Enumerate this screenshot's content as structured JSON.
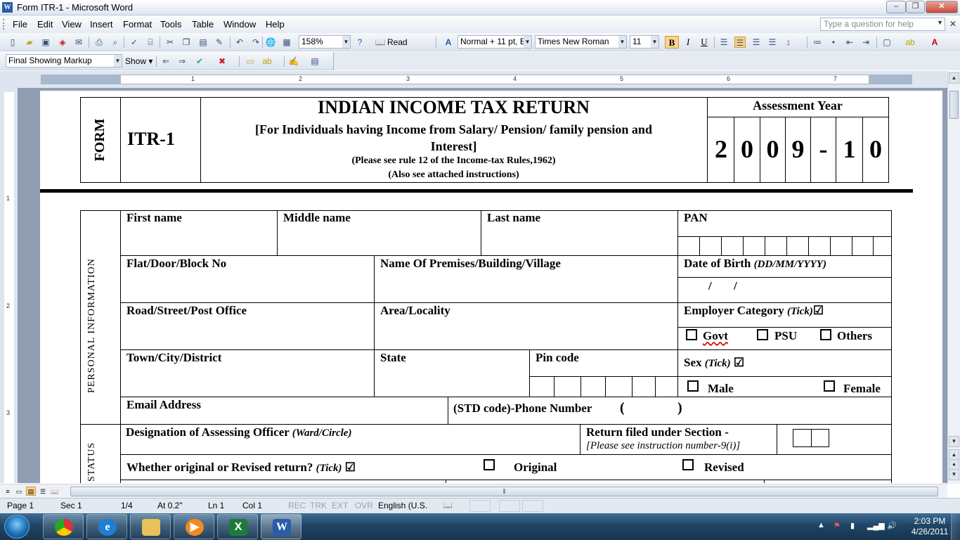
{
  "window": {
    "title": "Form ITR-1 - Microsoft Word",
    "app_icon": "W",
    "min_label": "–",
    "max_label": "❐",
    "close_label": "✕"
  },
  "menubar": {
    "items": [
      "File",
      "Edit",
      "View",
      "Insert",
      "Format",
      "Tools",
      "Table",
      "Window",
      "Help"
    ],
    "ask_placeholder": "Type a question for help",
    "close_doc": "✕"
  },
  "toolbar": {
    "zoom": "158%",
    "read_label": "Read",
    "style": "Normal + 11 pt, E",
    "font": "Times New Roman",
    "size": "11",
    "bold": "B",
    "italic": "I",
    "underline": "U"
  },
  "reviewing": {
    "markup": "Final Showing Markup",
    "show_label": "Show ▾"
  },
  "ruler": {
    "numbers": [
      "1",
      "2",
      "3",
      "4",
      "5",
      "6",
      "7"
    ],
    "vnumbers": [
      "1",
      "2",
      "3"
    ]
  },
  "form": {
    "form_label": "FORM",
    "form_code": "ITR-1",
    "title": "INDIAN INCOME TAX RETURN",
    "subtitle_1": "[For Individuals having Income from Salary/ Pension/ family pension and",
    "subtitle_2": "Interest]",
    "note_1": "(Please see rule 12 of the Income-tax Rules,1962)",
    "note_2": "(Also see attached instructions)",
    "assessment_label": "Assessment Year",
    "year_digits": [
      "2",
      "0",
      "0",
      "9",
      "-",
      "1",
      "0"
    ],
    "section_personal": "PERSONAL INFORMATION",
    "section_status": "STATUS",
    "first_name": "First name",
    "middle_name": "Middle name",
    "last_name": "Last name",
    "pan": "PAN",
    "flat": "Flat/Door/Block No",
    "premises": "Name Of Premises/Building/Village",
    "dob": "Date of Birth",
    "dob_format": "(DD/MM/YYYY)",
    "dob_slash_1": "/",
    "dob_slash_2": "/",
    "road": "Road/Street/Post Office",
    "area": "Area/Locality",
    "employer": "Employer Category",
    "tick": "(Tick)",
    "tickmark": "☑",
    "govt": "Govt",
    "psu": "PSU",
    "others": "Others",
    "town": "Town/City/District",
    "state": "State",
    "pin": "Pin code",
    "sex": "Sex",
    "male": "Male",
    "female": "Female",
    "email": "Email Address",
    "phone": "(STD code)-Phone Number",
    "phone_open": "(",
    "phone_close": ")",
    "designation": "Designation of Assessing Officer",
    "ward": "(Ward/Circle)",
    "return_filed": "Return filed under Section -",
    "return_instr": "[Please see instruction number-9(i)]",
    "original_revised": "Whether original or Revised return?",
    "original": "Original",
    "revised": "Revised"
  },
  "statusbar": {
    "page": "Page  1",
    "sec": "Sec  1",
    "pages": "1/4",
    "at": "At  0.2\"",
    "ln": "Ln  1",
    "col": "Col  1",
    "rec": "REC",
    "trk": "TRK",
    "ext": "EXT",
    "ovr": "OVR",
    "lang": "English (U.S."
  },
  "taskbar": {
    "apps": [
      "chrome-icon",
      "internet-explorer-icon",
      "explorer-icon",
      "media-player-icon",
      "excel-icon",
      "word-icon"
    ],
    "time": "2:03 PM",
    "date": "4/26/2011",
    "show_hidden": "▲"
  }
}
